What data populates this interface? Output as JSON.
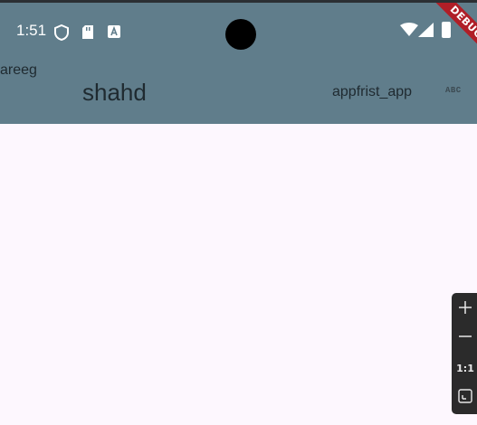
{
  "status_bar": {
    "time": "1:51",
    "icons": [
      "shield-icon",
      "sd-card-icon",
      "text-a-icon",
      "wifi-icon",
      "signal-icon",
      "battery-icon"
    ]
  },
  "app_bar": {
    "leading_text": "areeg",
    "title": "shahd",
    "action_text": "appfrist_app",
    "action_icon": "abc-icon",
    "action_icon_label": "ABC",
    "background": "#607d8b"
  },
  "debug_banner": {
    "label": "DEBUG",
    "color": "#b01e27"
  },
  "zoom_controls": {
    "zoom_in": "zoom-in-icon",
    "zoom_out": "zoom-out-icon",
    "actual_size_label": "1:1",
    "fit": "fit-screen-icon"
  },
  "colors": {
    "body_background": "#fdf7fe"
  }
}
